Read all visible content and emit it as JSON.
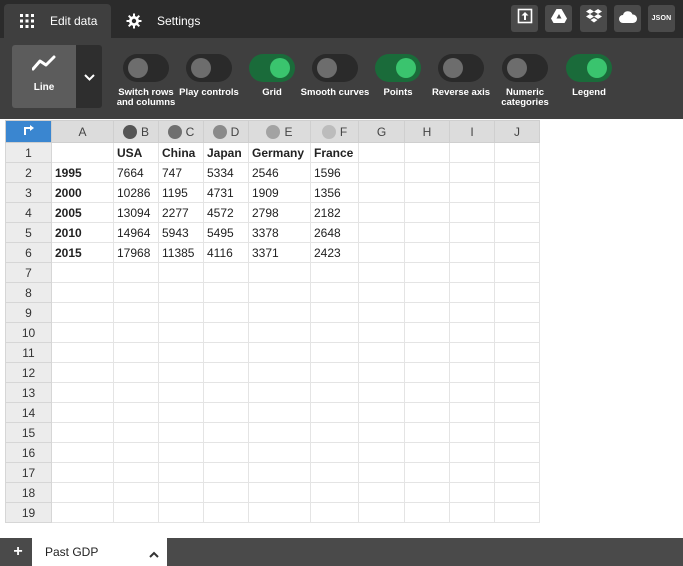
{
  "tabs": [
    {
      "label": "Edit data",
      "icon": "grid-icon",
      "active": true
    },
    {
      "label": "Settings",
      "icon": "gear-icon",
      "active": false
    }
  ],
  "top_actions": [
    {
      "name": "publish-button",
      "icon": "upload-icon"
    },
    {
      "name": "google-drive-button",
      "icon": "drive-icon"
    },
    {
      "name": "dropbox-button",
      "icon": "dropbox-icon"
    },
    {
      "name": "cloud-button",
      "icon": "cloud-icon"
    },
    {
      "name": "json-button",
      "label": "JSON"
    }
  ],
  "chart_type": {
    "label": "Line",
    "icon": "line-chart-icon"
  },
  "toggles": [
    {
      "label": "Switch rows\nand columns",
      "on": false
    },
    {
      "label": "Play controls",
      "on": false
    },
    {
      "label": "Grid",
      "on": true
    },
    {
      "label": "Smooth curves",
      "on": false
    },
    {
      "label": "Points",
      "on": true
    },
    {
      "label": "Reverse axis",
      "on": false
    },
    {
      "label": "Numeric\ncategories",
      "on": false
    },
    {
      "label": "Legend",
      "on": true
    }
  ],
  "grid": {
    "columns": [
      "A",
      "B",
      "C",
      "D",
      "E",
      "F",
      "G",
      "H",
      "I",
      "J"
    ],
    "series_dot_colors": {
      "B": "#555555",
      "C": "#707070",
      "D": "#8a8a8a",
      "E": "#a3a3a3",
      "F": "#bcbcbc"
    },
    "header_row": [
      "",
      "USA",
      "China",
      "Japan",
      "Germany",
      "France",
      "",
      "",
      "",
      ""
    ],
    "data_rows": [
      [
        "1995",
        "7664",
        "747",
        "5334",
        "2546",
        "1596",
        "",
        "",
        "",
        ""
      ],
      [
        "2000",
        "10286",
        "1195",
        "4731",
        "1909",
        "1356",
        "",
        "",
        "",
        ""
      ],
      [
        "2005",
        "13094",
        "2277",
        "4572",
        "2798",
        "2182",
        "",
        "",
        "",
        ""
      ],
      [
        "2010",
        "14964",
        "5943",
        "5495",
        "3378",
        "2648",
        "",
        "",
        "",
        ""
      ],
      [
        "2015",
        "17968",
        "11385",
        "4116",
        "3371",
        "2423",
        "",
        "",
        "",
        ""
      ]
    ],
    "row_numbers": [
      "1",
      "2",
      "3",
      "4",
      "5",
      "6",
      "7",
      "8",
      "9",
      "10",
      "11",
      "12",
      "13",
      "14",
      "15",
      "16",
      "17",
      "18",
      "19"
    ]
  },
  "sheet": {
    "name": "Past GDP",
    "add_label": "+"
  }
}
